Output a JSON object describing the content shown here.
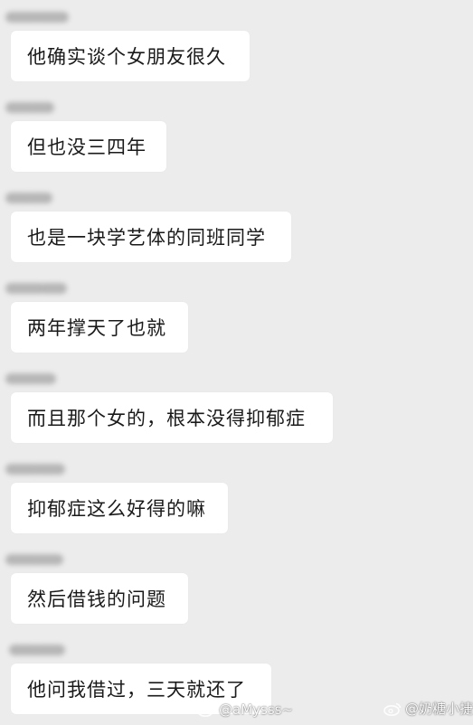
{
  "messages": [
    {
      "text": "他确实谈个女朋友很久"
    },
    {
      "text": "但也没三四年"
    },
    {
      "text": "也是一块学艺体的同班同学"
    },
    {
      "text": "两年撑天了也就"
    },
    {
      "text": "而且那个女的，根本没得抑郁症"
    },
    {
      "text": "抑郁症这么好得的嘛"
    },
    {
      "text": "然后借钱的问题"
    },
    {
      "text": "他问我借过，三天就还了"
    }
  ],
  "watermarks": {
    "left": "@aMysss~",
    "right": "@奶糖小捷"
  },
  "colors": {
    "background": "#ececec",
    "bubble": "#ffffff",
    "text": "#1a1a1a"
  },
  "icons": {
    "watermark": "weibo-icon"
  }
}
